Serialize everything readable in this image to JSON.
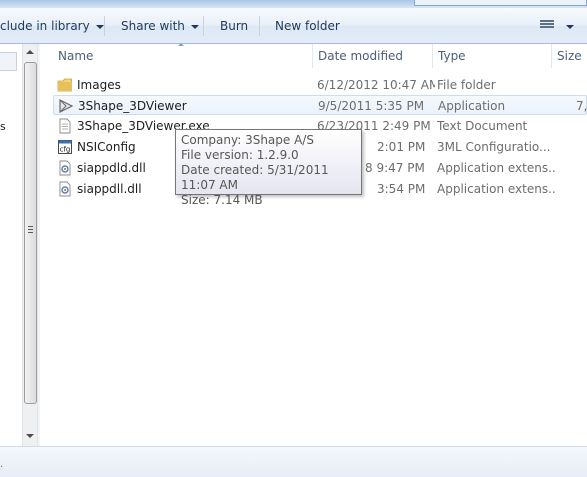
{
  "toolbar": {
    "include_library": "clude in library",
    "share_with": "Share with",
    "burn": "Burn",
    "new_folder": "New folder"
  },
  "nav": {
    "partial_text": "s",
    "tail_text": "."
  },
  "columns": {
    "name": "Name",
    "date_modified": "Date modified",
    "type": "Type",
    "size": "Size"
  },
  "files": [
    {
      "icon": "folder-icon",
      "name": "Images",
      "date": "6/12/2012 10:47 AM",
      "type": "File folder",
      "size": ""
    },
    {
      "icon": "application-icon",
      "name": "3Shape_3DViewer",
      "date": "9/5/2011 5:35 PM",
      "type": "Application",
      "size": "7,"
    },
    {
      "icon": "text-document-icon",
      "name": "3Shape_3DViewer.exe",
      "date": "6/23/2011 2:49 PM",
      "type": "Text Document",
      "size": ""
    },
    {
      "icon": "config-file-icon",
      "name": "NSIConfig",
      "date": "2:01 PM",
      "type": "3ML Configuratio...",
      "size": ""
    },
    {
      "icon": "dll-file-icon",
      "name": "siappdld.dll",
      "date": "8 9:47 PM",
      "type": "Application extens...",
      "size": ""
    },
    {
      "icon": "dll-file-icon",
      "name": "siappdll.dll",
      "date": "3:54 PM",
      "type": "Application extens...",
      "size": ""
    }
  ],
  "tooltip": {
    "company": "Company: 3Shape A/S",
    "file_version": "File version: 1.2.9.0",
    "date_created": "Date created: 5/31/2011 11:07 AM",
    "size": "Size: 7.14 MB"
  },
  "colors": {
    "toolbar_text": "#1e395b",
    "header_text": "#4c607a",
    "secondary_text": "#6d6d6d",
    "folder": "#e8c15a"
  }
}
